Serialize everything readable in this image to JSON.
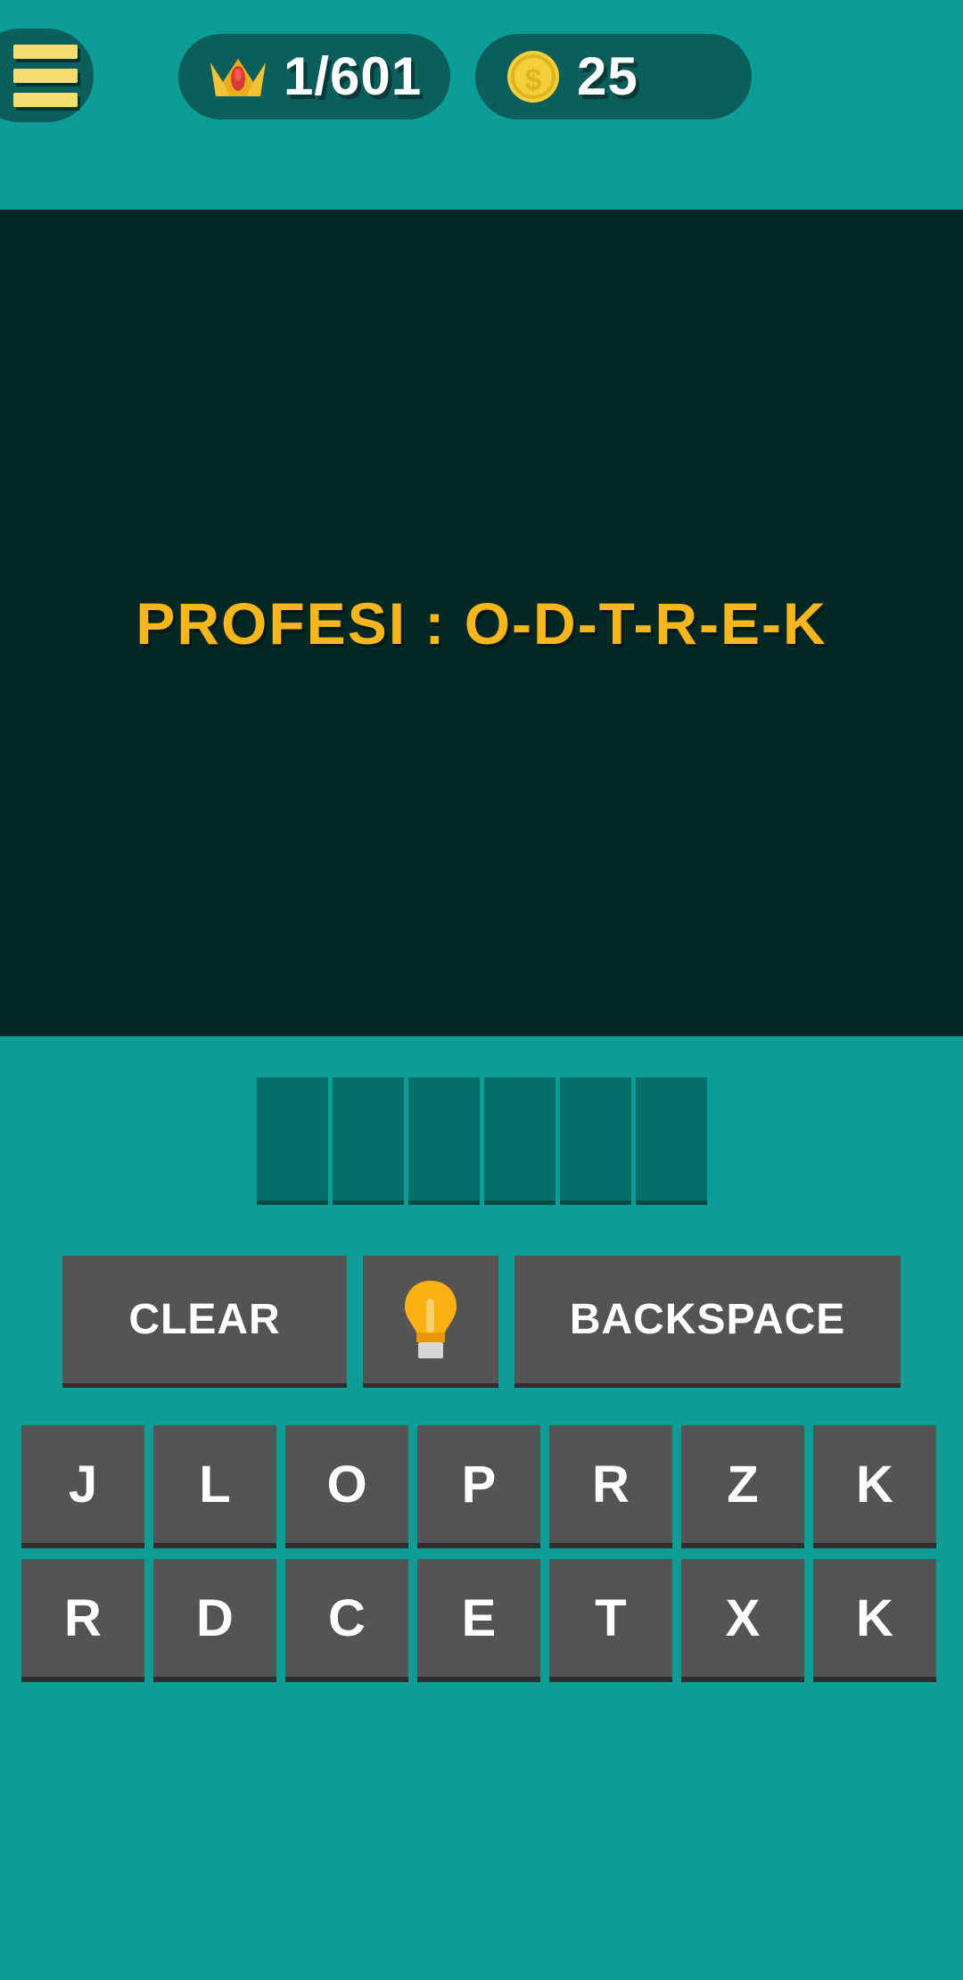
{
  "theme": {
    "background_teal": "#0C9E96",
    "panel_dark": "#042823",
    "pill_dark_teal": "#0C5E5B",
    "accent_gold": "#F7B61C",
    "slot_teal": "#056E68",
    "key_gray": "#545454",
    "text_white": "#FFFFFF",
    "menu_bar_yellow": "#F4DE72"
  },
  "header": {
    "menu_icon": "hamburger-icon",
    "level": {
      "icon": "crown-icon",
      "value": "1/601"
    },
    "coins": {
      "icon": "coin-icon",
      "value": "25"
    }
  },
  "question": {
    "label": "PROFESI",
    "separator": ":",
    "hint_letters": "O-D-T-R-E-K",
    "text": "PROFESI : O-D-T-R-E-K"
  },
  "answer": {
    "slot_count": 6,
    "slots": [
      "",
      "",
      "",
      "",
      "",
      ""
    ]
  },
  "actions": {
    "clear_label": "CLEAR",
    "hint_icon": "lightbulb-icon",
    "backspace_label": "BACKSPACE"
  },
  "keyboard": {
    "rows": [
      [
        "J",
        "L",
        "O",
        "P",
        "R",
        "Z",
        "K"
      ],
      [
        "R",
        "D",
        "C",
        "E",
        "T",
        "X",
        "K"
      ]
    ]
  }
}
